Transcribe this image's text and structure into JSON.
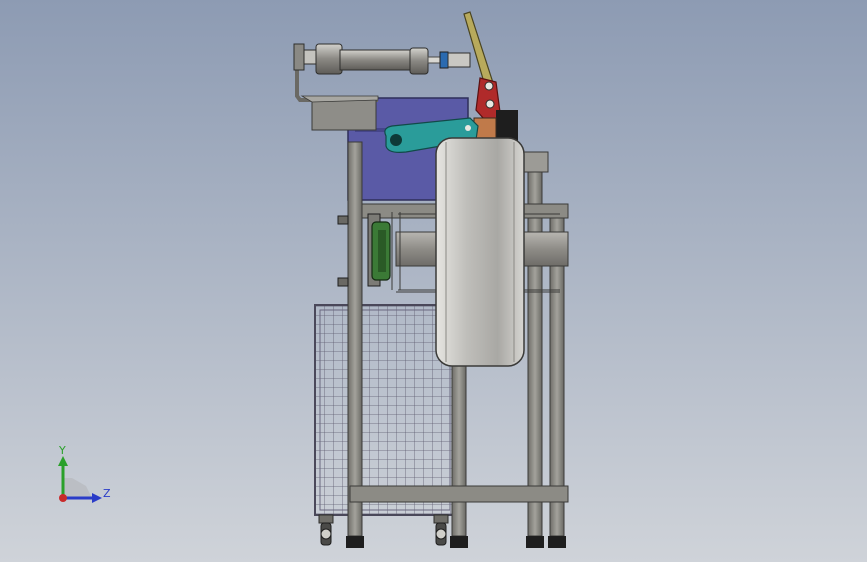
{
  "viewport": {
    "background_top": "#8d9bb3",
    "background_bottom": "#cfd3d9"
  },
  "colors": {
    "frame_steel": "#8c8b85",
    "frame_edge": "#3a3a38",
    "motor_housing": "#5a5aa6",
    "teal_arm": "#2a9c9a",
    "red_link": "#b02a2a",
    "flange_green": "#3b7a36",
    "wheel_face": "#c7c6c2",
    "roller_shaft": "#9a9792",
    "cylinder_body": "#8f8d88",
    "lever_olive": "#b8aa5c",
    "mesh_wire": "#5c5a6e",
    "foot_black": "#1e1e1e",
    "y_axis": "#2aa02a",
    "z_axis": "#2a3cc8",
    "x_axis": "#c82a2a"
  },
  "triad": {
    "y_label": "Y",
    "z_label": "Z"
  }
}
